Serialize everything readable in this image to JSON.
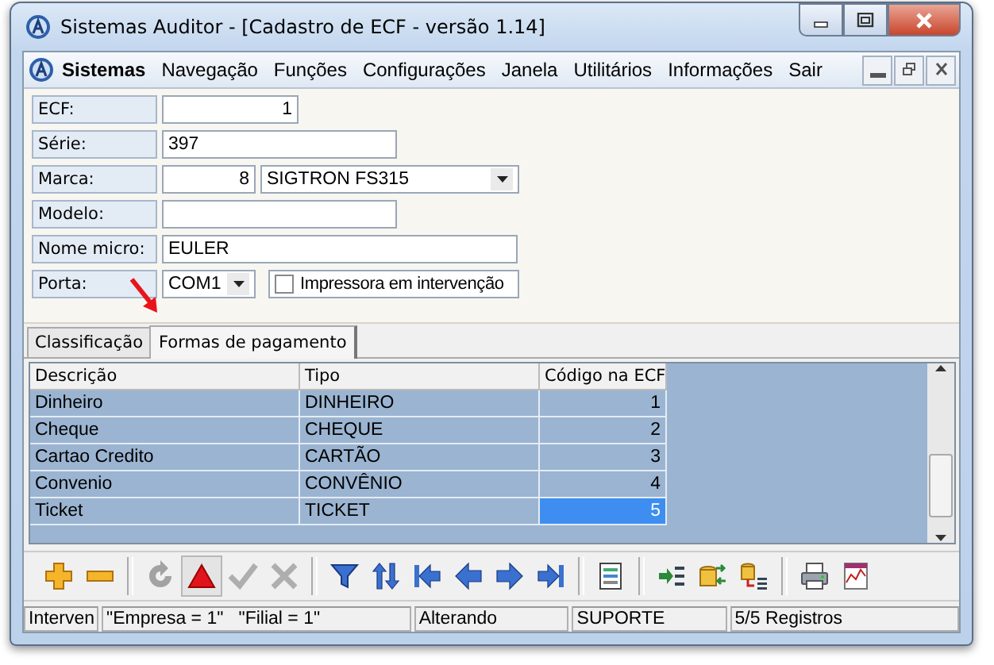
{
  "window": {
    "title": "Sistemas Auditor - [Cadastro de ECF - versão 1.14]"
  },
  "menu": [
    {
      "label": "Sistemas",
      "bold": true
    },
    {
      "label": "Navegação",
      "bold": false
    },
    {
      "label": "Funções",
      "bold": false
    },
    {
      "label": "Configurações",
      "bold": false
    },
    {
      "label": "Janela",
      "bold": false
    },
    {
      "label": "Utilitários",
      "bold": false
    },
    {
      "label": "Informações",
      "bold": false
    },
    {
      "label": "Sair",
      "bold": false
    }
  ],
  "form": [
    {
      "label": "ECF:",
      "fields": [
        {
          "kind": "number",
          "value": "1"
        }
      ]
    },
    {
      "label": "Série:",
      "fields": [
        {
          "kind": "text",
          "value": "397"
        }
      ]
    },
    {
      "label": "Marca:",
      "fields": [
        {
          "kind": "number",
          "value": "8"
        },
        {
          "kind": "combo",
          "value": "SIGTRON FS315"
        }
      ]
    },
    {
      "label": "Modelo:",
      "fields": [
        {
          "kind": "text"
        }
      ]
    },
    {
      "label": "Nome micro:",
      "fields": [
        {
          "kind": "text",
          "value": "EULER"
        }
      ]
    },
    {
      "label": "Porta:",
      "fields": [
        {
          "kind": "combo",
          "value": "COM1"
        },
        {
          "kind": "checkbox",
          "label": "Impressora em intervenção",
          "checked": false
        }
      ]
    }
  ],
  "tabs": [
    {
      "label": "Classificação",
      "selected": false
    },
    {
      "label": "Formas de pagamento",
      "selected": true
    }
  ],
  "table": {
    "columns": [
      "Descrição",
      "Tipo",
      "Código na ECF"
    ],
    "rows": [
      {
        "cells": [
          "Dinheiro",
          "DINHEIRO",
          "1"
        ],
        "selected": false
      },
      {
        "cells": [
          "Cheque",
          "CHEQUE",
          "2"
        ],
        "selected": false
      },
      {
        "cells": [
          "Cartao Credito",
          "CARTÃO",
          "3"
        ],
        "selected": false
      },
      {
        "cells": [
          "Convenio",
          "CONVÊNIO",
          "4"
        ],
        "selected": false
      },
      {
        "cells": [
          "Ticket",
          "TICKET",
          "5"
        ],
        "selected": true
      }
    ]
  },
  "toolbar": [
    {
      "kind": "add",
      "disabled": false,
      "pressed": false
    },
    {
      "kind": "remove",
      "disabled": false,
      "pressed": false
    },
    {
      "kind": "sep"
    },
    {
      "kind": "refresh",
      "disabled": true,
      "pressed": false
    },
    {
      "kind": "triangle",
      "disabled": false,
      "pressed": true
    },
    {
      "kind": "confirm",
      "disabled": true,
      "pressed": false
    },
    {
      "kind": "cancel",
      "disabled": true,
      "pressed": false
    },
    {
      "kind": "sep"
    },
    {
      "kind": "filter",
      "disabled": false,
      "pressed": false
    },
    {
      "kind": "sort",
      "disabled": false,
      "pressed": false
    },
    {
      "kind": "first",
      "disabled": false,
      "pressed": false
    },
    {
      "kind": "prev",
      "disabled": false,
      "pressed": false
    },
    {
      "kind": "next",
      "disabled": false,
      "pressed": false
    },
    {
      "kind": "last",
      "disabled": false,
      "pressed": false
    },
    {
      "kind": "sep"
    },
    {
      "kind": "form",
      "disabled": false,
      "pressed": false
    },
    {
      "kind": "sep"
    },
    {
      "kind": "import",
      "disabled": false,
      "pressed": false
    },
    {
      "kind": "exchange",
      "disabled": false,
      "pressed": false
    },
    {
      "kind": "export",
      "disabled": false,
      "pressed": false
    },
    {
      "kind": "sep"
    },
    {
      "kind": "print",
      "disabled": false,
      "pressed": false
    },
    {
      "kind": "chart",
      "disabled": false,
      "pressed": false
    }
  ],
  "status_bar": [
    "Interven",
    "\"Empresa = 1\"   \"Filial = 1\"",
    "Alterando",
    "SUPORTE",
    "5/5 Registros"
  ]
}
